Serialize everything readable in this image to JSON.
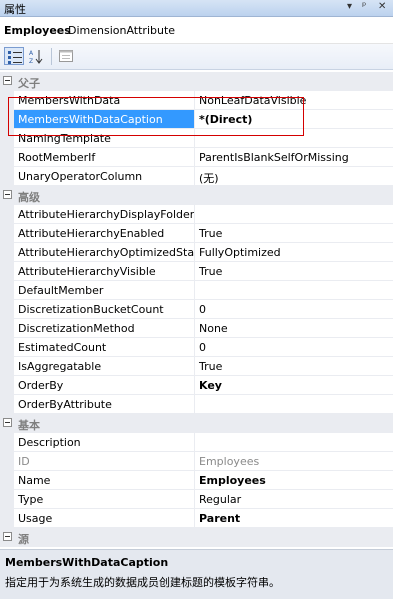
{
  "window": {
    "title": "属性",
    "buttons": {
      "dropdown": "▾",
      "pin": "ᵖ",
      "close": "✕"
    }
  },
  "object": {
    "name": "Employees",
    "type": "DimensionAttribute"
  },
  "toolbar": {
    "items": [
      {
        "icon": "categorized-icon",
        "active": true
      },
      {
        "icon": "alphabetical-sort-icon",
        "active": false
      },
      {
        "icon": "property-pages-icon",
        "active": false
      }
    ]
  },
  "categories": [
    {
      "label": "父子",
      "rows": [
        {
          "name": "MembersWithData",
          "value": "NonLeafDataVisible"
        },
        {
          "name": "MembersWithDataCaption",
          "value": "*(Direct)",
          "selected": true,
          "bold": true
        },
        {
          "name": "NamingTemplate",
          "value": ""
        },
        {
          "name": "RootMemberIf",
          "value": "ParentIsBlankSelfOrMissing"
        },
        {
          "name": "UnaryOperatorColumn",
          "value": "(无)"
        }
      ]
    },
    {
      "label": "高级",
      "rows": [
        {
          "name": "AttributeHierarchyDisplayFolder",
          "value": ""
        },
        {
          "name": "AttributeHierarchyEnabled",
          "value": "True"
        },
        {
          "name": "AttributeHierarchyOptimizedState",
          "value": "FullyOptimized"
        },
        {
          "name": "AttributeHierarchyVisible",
          "value": "True"
        },
        {
          "name": "DefaultMember",
          "value": ""
        },
        {
          "name": "DiscretizationBucketCount",
          "value": "0"
        },
        {
          "name": "DiscretizationMethod",
          "value": "None"
        },
        {
          "name": "EstimatedCount",
          "value": "0"
        },
        {
          "name": "IsAggregatable",
          "value": "True"
        },
        {
          "name": "OrderBy",
          "value": "Key",
          "bold": true
        },
        {
          "name": "OrderByAttribute",
          "value": ""
        }
      ]
    },
    {
      "label": "基本",
      "rows": [
        {
          "name": "Description",
          "value": ""
        },
        {
          "name": "ID",
          "value": "Employees",
          "disabled": true
        },
        {
          "name": "Name",
          "value": "Employees",
          "bold": true
        },
        {
          "name": "Type",
          "value": "Regular"
        },
        {
          "name": "Usage",
          "value": "Parent",
          "bold": true
        }
      ]
    },
    {
      "label": "源",
      "rows": []
    }
  ],
  "description": {
    "title": "MembersWithDataCaption",
    "text": "指定用于为系统生成的数据成员创建标题的模板字符串。"
  }
}
